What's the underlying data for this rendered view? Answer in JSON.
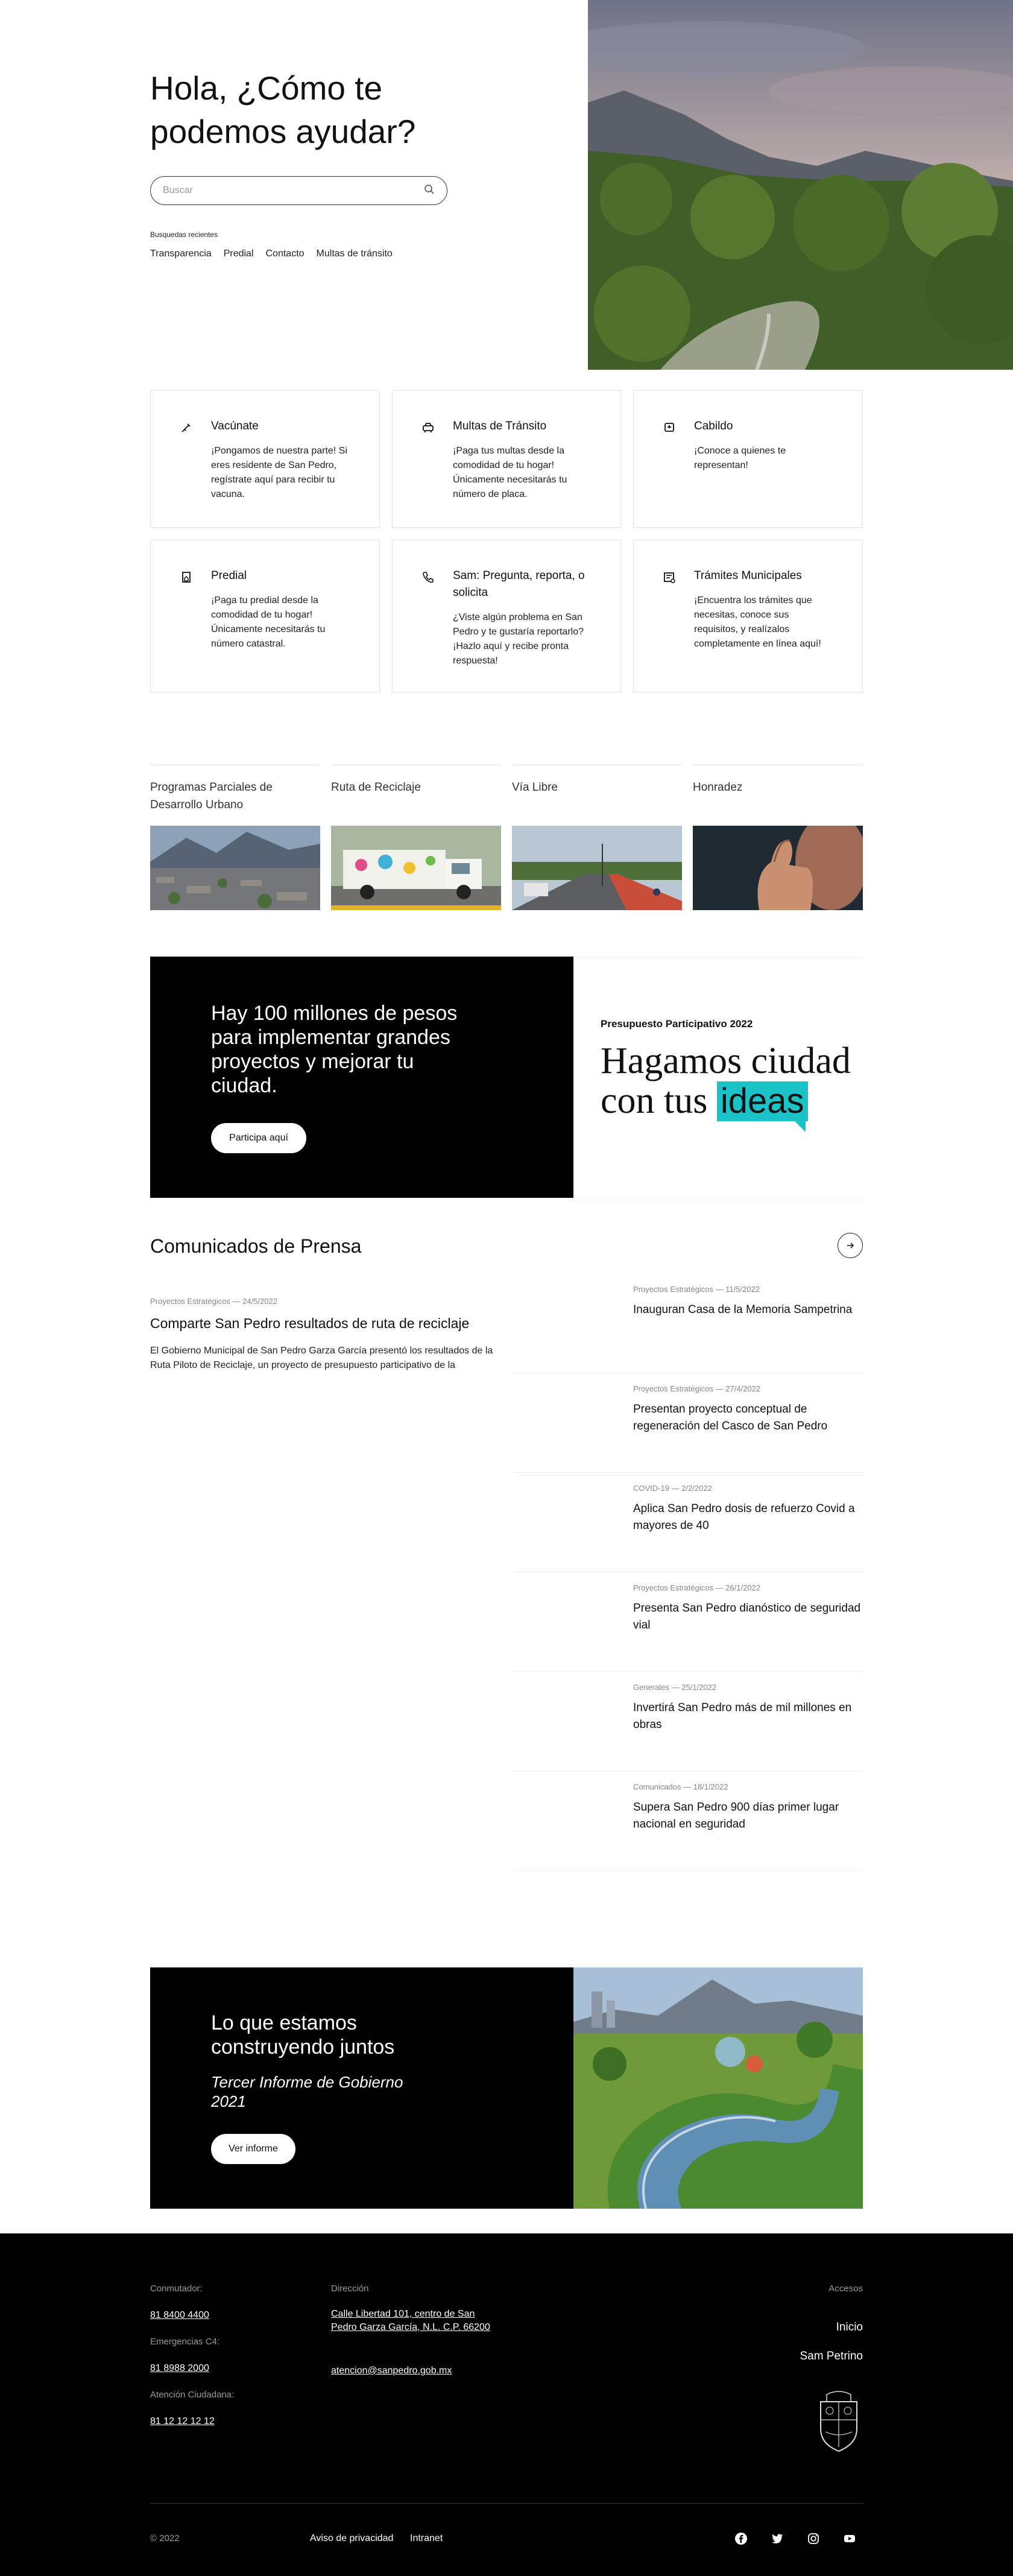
{
  "hero": {
    "title": "Hola, ¿Cómo te podemos ayudar?",
    "search_placeholder": "Buscar",
    "recent_label": "Busquedas recientes",
    "recent_links": [
      "Transparencia",
      "Predial",
      "Contacto",
      "Multas de tránsito"
    ]
  },
  "services": [
    {
      "title": "Vacúnate",
      "desc": "¡Pongamos de nuestra parte! Si eres residente de San Pedro, regístrate aquí para recibir tu vacuna.",
      "icon": "syringe-icon"
    },
    {
      "title": "Multas de Tránsito",
      "desc": "¡Paga tus multas desde la comodidad de tu hogar! Únicamente necesitarás tu número de placa.",
      "icon": "car-icon"
    },
    {
      "title": "Cabildo",
      "desc": "¡Conoce a quienes te representan!",
      "icon": "podium-icon"
    },
    {
      "title": "Predial",
      "desc": "¡Paga tu predial desde la comodidad de tu hogar! Únicamente necesitarás tu número catastral.",
      "icon": "house-document-icon"
    },
    {
      "title": "Sam: Pregunta, reporta, o solicita",
      "desc": "¿Viste algún problema en San Pedro y te gustaría reportarlo? ¡Hazlo aquí y recibe pronta respuesta!",
      "icon": "phone-icon"
    },
    {
      "title": "Trámites Municipales",
      "desc": "¡Encuentra los trámites que necesitas, conoce sus requisitos, y realízalos completamente en línea aquí!",
      "icon": "form-icon"
    }
  ],
  "programs": [
    {
      "title": "Programas Parciales de Desarrollo Urbano"
    },
    {
      "title": "Ruta de Reciclaje"
    },
    {
      "title": "Vía Libre"
    },
    {
      "title": "Honradez"
    }
  ],
  "budget": {
    "text": "Hay 100 millones de pesos para implementar grandes proyectos y mejorar tu ciudad.",
    "button": "Participa aquí",
    "label": "Presupuesto Participativo 2022",
    "slogan_line1": "Hagamos ciudad",
    "slogan_line2": "con tus",
    "slogan_highlight": "ideas",
    "highlight_color": "#19c3c7"
  },
  "press": {
    "title": "Comunicados de Prensa",
    "featured": {
      "meta": "Proyectos Estratégicos — 24/5/2022",
      "title": "Comparte San Pedro resultados de ruta de reciclaje",
      "desc": "El Gobierno Municipal de San Pedro Garza García presentó los resultados de la Ruta Piloto de Reciclaje, un proyecto de presupuesto participativo de la"
    },
    "items": [
      {
        "meta": "Proyectos Estratégicos — 11/5/2022",
        "title": "Inauguran Casa de la Memoria Sampetrina"
      },
      {
        "meta": "Proyectos Estratégicos — 27/4/2022",
        "title": "Presentan proyecto conceptual de regeneración del Casco de San Pedro"
      },
      {
        "meta": "COVID-19 — 2/2/2022",
        "title": "Aplica San Pedro dosis de refuerzo Covid a mayores de 40"
      },
      {
        "meta": "Proyectos Estratégicos — 26/1/2022",
        "title": "Presenta San Pedro dianóstico de seguridad vial"
      },
      {
        "meta": "Generales — 25/1/2022",
        "title": "Invertirá San Pedro más de mil millones en obras"
      },
      {
        "meta": "Comunicados — 18/1/2022",
        "title": "Supera San Pedro 900 días primer lugar nacional en seguridad"
      }
    ]
  },
  "report": {
    "title": "Lo que estamos construyendo juntos",
    "subtitle": "Tercer Informe de Gobierno 2021",
    "button": "Ver informe"
  },
  "footer": {
    "switchboard_label": "Conmutador:",
    "switchboard": "81 8400 4400",
    "emergency_label": "Emergencias C4:",
    "emergency": "81 8988 2000",
    "citizen_label": "Atención Ciudadana:",
    "citizen": "81 12 12 12 12",
    "address_label": "Dirección",
    "address": "Calle Libertad 101, centro de San Pedro Garza García, N.L. C.P. 66200",
    "email": "atencion@sanpedro.gob.mx",
    "access_label": "Accesos",
    "access_links": [
      "Inicio",
      "Sam Petrino"
    ],
    "copyright": "© 2022",
    "bottom_links": [
      "Aviso de privacidad",
      "Intranet"
    ]
  }
}
